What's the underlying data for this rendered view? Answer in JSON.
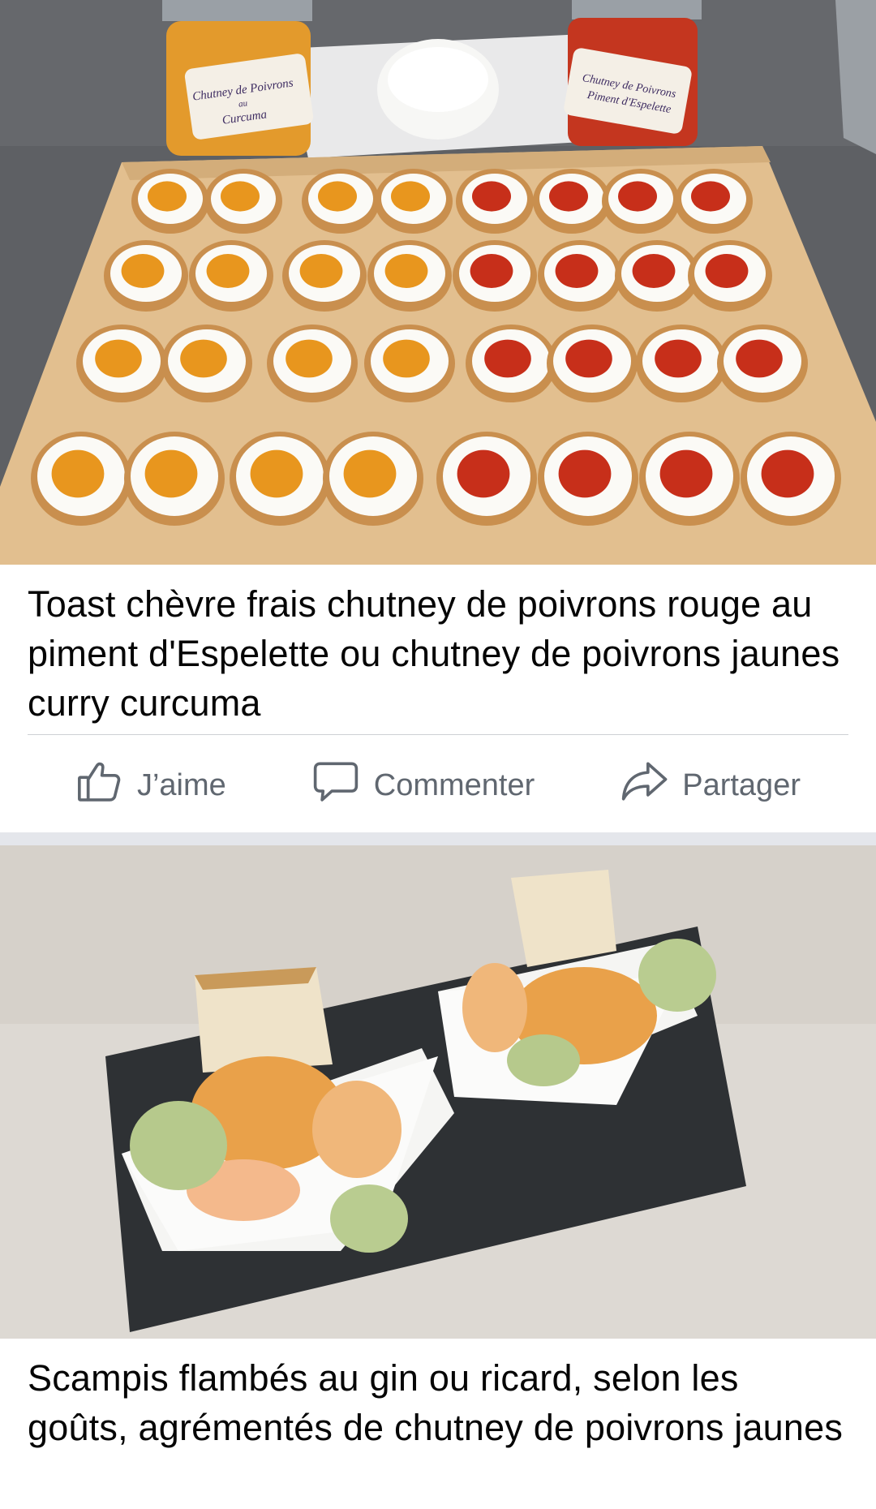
{
  "posts": [
    {
      "photo": {
        "subject": "toasts-chevre-chutney",
        "labels": {
          "jar_left": [
            "Chutney de Poivrons",
            "au",
            "Curcuma"
          ],
          "jar_right": [
            "Chutney de Poivrons",
            "Piment d'Espelette"
          ]
        }
      },
      "caption": "Toast chèvre frais chutney de poivrons rouge au piment d'Espelette ou chutney de poivrons jaunes curry curcuma",
      "actions": {
        "like": "J’aime",
        "comment": "Commenter",
        "share": "Partager"
      }
    },
    {
      "photo": {
        "subject": "scampis-flambes"
      },
      "caption": "Scampis flambés  au gin ou ricard, selon les goûts, agrémentés de chutney de poivrons jaunes"
    }
  ],
  "icons": {
    "like": "thumbs-up-icon",
    "comment": "speech-bubble-icon",
    "share": "share-arrow-icon"
  },
  "colors": {
    "background": "#e4e6eb",
    "card": "#ffffff",
    "text": "#050505",
    "action_text": "#606770",
    "divider": "#ced0d4"
  }
}
